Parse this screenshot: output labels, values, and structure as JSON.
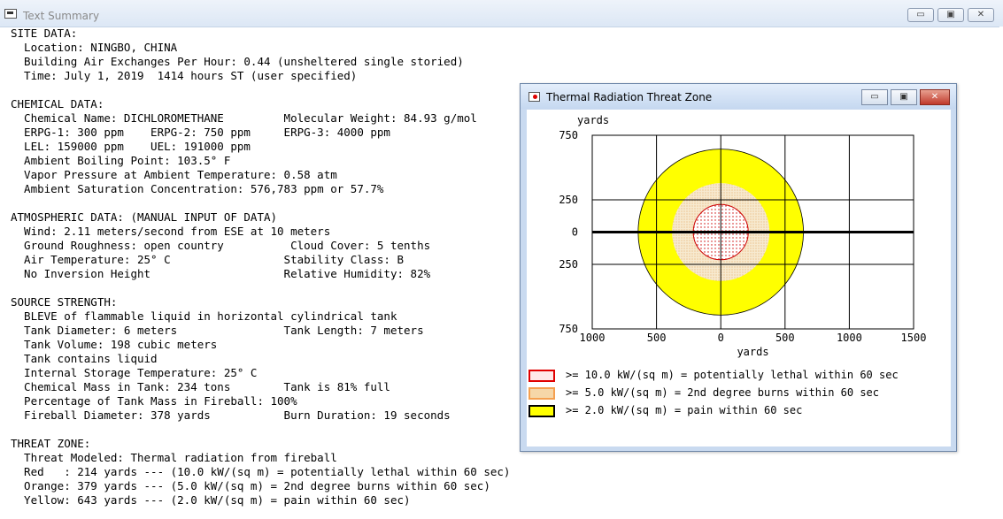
{
  "window": {
    "title": "Text Summary",
    "controls": {
      "minimize": "▭",
      "restore": "▣",
      "close": "✕"
    }
  },
  "summary_lines": [
    "SITE DATA:",
    "  Location: NINGBO, CHINA",
    "  Building Air Exchanges Per Hour: 0.44 (unsheltered single storied)",
    "  Time: July 1, 2019  1414 hours ST (user specified)",
    "",
    "CHEMICAL DATA:",
    "  Chemical Name: DICHLOROMETHANE         Molecular Weight: 84.93 g/mol",
    "  ERPG-1: 300 ppm    ERPG-2: 750 ppm     ERPG-3: 4000 ppm",
    "  LEL: 159000 ppm    UEL: 191000 ppm",
    "  Ambient Boiling Point: 103.5° F",
    "  Vapor Pressure at Ambient Temperature: 0.58 atm",
    "  Ambient Saturation Concentration: 576,783 ppm or 57.7%",
    "",
    "ATMOSPHERIC DATA: (MANUAL INPUT OF DATA)",
    "  Wind: 2.11 meters/second from ESE at 10 meters",
    "  Ground Roughness: open country          Cloud Cover: 5 tenths",
    "  Air Temperature: 25° C                 Stability Class: B",
    "  No Inversion Height                    Relative Humidity: 82%",
    "",
    "SOURCE STRENGTH:",
    "  BLEVE of flammable liquid in horizontal cylindrical tank",
    "  Tank Diameter: 6 meters                Tank Length: 7 meters",
    "  Tank Volume: 198 cubic meters",
    "  Tank contains liquid",
    "  Internal Storage Temperature: 25° C",
    "  Chemical Mass in Tank: 234 tons        Tank is 81% full",
    "  Percentage of Tank Mass in Fireball: 100%",
    "  Fireball Diameter: 378 yards           Burn Duration: 19 seconds",
    "",
    "THREAT ZONE:",
    "  Threat Modeled: Thermal radiation from fireball",
    "  Red   : 214 yards --- (10.0 kW/(sq m) = potentially lethal within 60 sec)",
    "  Orange: 379 yards --- (5.0 kW/(sq m) = 2nd degree burns within 60 sec)",
    "  Yellow: 643 yards --- (2.0 kW/(sq m) = pain within 60 sec)"
  ],
  "popup": {
    "title": "Thermal Radiation Threat Zone",
    "controls": {
      "minimize": "▭",
      "restore": "▣",
      "close": "✕"
    }
  },
  "chart_data": {
    "type": "threat-zone-plot",
    "y_unit_label": "yards",
    "x_unit_label": "yards",
    "y_ticks": [
      "750",
      "250",
      "0",
      "250",
      "750"
    ],
    "x_ticks": [
      "1000",
      "500",
      "0",
      "500",
      "1000",
      "1500"
    ],
    "xlim": [
      -1000,
      1500
    ],
    "ylim": [
      -750,
      750
    ],
    "zones": [
      {
        "name": "Yellow",
        "radius_yards": 643,
        "color": "#ffff00",
        "legend": ">= 2.0 kW/(sq m) = pain within 60 sec"
      },
      {
        "name": "Orange",
        "radius_yards": 379,
        "color": "#f5e6c8",
        "legend": ">= 5.0 kW/(sq m) = 2nd degree burns within 60 sec"
      },
      {
        "name": "Red",
        "radius_yards": 214,
        "color": "#ffffff",
        "legend": ">= 10.0 kW/(sq m) = potentially lethal within 60 sec"
      }
    ],
    "legend_order": [
      {
        "label": ">= 10.0 kW/(sq m) = potentially lethal within 60 sec",
        "border": "#e00000",
        "fill": "#ffe8e8"
      },
      {
        "label": ">= 5.0 kW/(sq m) = 2nd degree burns within 60 sec",
        "border": "#f5a050",
        "fill": "#f6d7a8"
      },
      {
        "label": ">= 2.0 kW/(sq m) = pain within 60 sec",
        "border": "#000000",
        "fill": "#ffff00"
      }
    ]
  }
}
